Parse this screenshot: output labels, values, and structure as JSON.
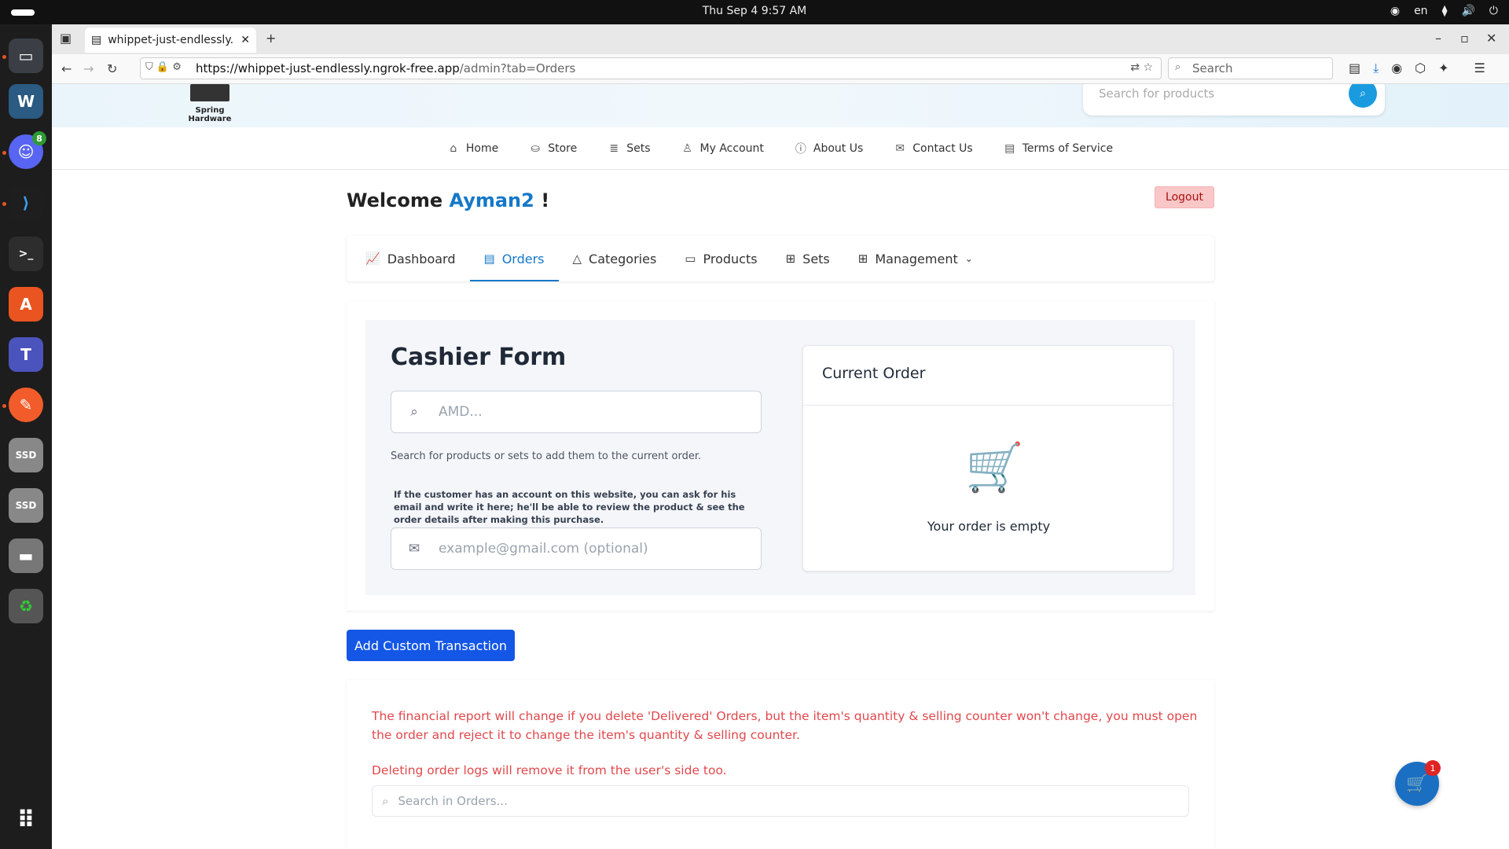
{
  "system": {
    "clock": "Thu Sep 4   9:57 AM",
    "lang": "en"
  },
  "dock": {
    "discord_badge": "8"
  },
  "browser": {
    "tab_title": "whippet-just-endlessly.ngrok-free.app",
    "url_host": "https://whippet-just-endlessly.ngrok-free.app",
    "url_path": "/admin?tab=Orders",
    "search_placeholder": "Search"
  },
  "site": {
    "logo_text": "Spring Hardware",
    "search_placeholder": "Search for products",
    "menu": [
      {
        "label": "Home"
      },
      {
        "label": "Store"
      },
      {
        "label": "Sets"
      },
      {
        "label": "My Account"
      },
      {
        "label": "About Us"
      },
      {
        "label": "Contact Us"
      },
      {
        "label": "Terms of Service"
      }
    ]
  },
  "admin": {
    "welcome_prefix": "Welcome",
    "username": "Ayman2",
    "welcome_suffix": "!",
    "logout_label": "Logout",
    "tabs": [
      {
        "label": "Dashboard"
      },
      {
        "label": "Orders"
      },
      {
        "label": "Categories"
      },
      {
        "label": "Products"
      },
      {
        "label": "Sets"
      },
      {
        "label": "Management"
      }
    ]
  },
  "cashier": {
    "title": "Cashier Form",
    "product_placeholder": "AMD...",
    "product_hint": "Search for products or sets to add them to the current order.",
    "email_note": "If the customer has an account on this website, you can ask for his email and write it here; he'll be able to review the product & see the order details after making this purchase.",
    "email_placeholder": "example@gmail.com (optional)",
    "current_order_title": "Current Order",
    "empty_text": "Your order is empty"
  },
  "actions": {
    "add_custom_label": "Add Custom Transaction"
  },
  "orders": {
    "warning_1": "The financial report will change if you delete 'Delivered' Orders, but the item's quantity & selling counter won't change, you must open the order and reject it to change the item's quantity & selling counter.",
    "warning_2": "Deleting order logs will remove it from the user's side too.",
    "search_placeholder": "Search in Orders..."
  },
  "cart": {
    "count": "1"
  }
}
